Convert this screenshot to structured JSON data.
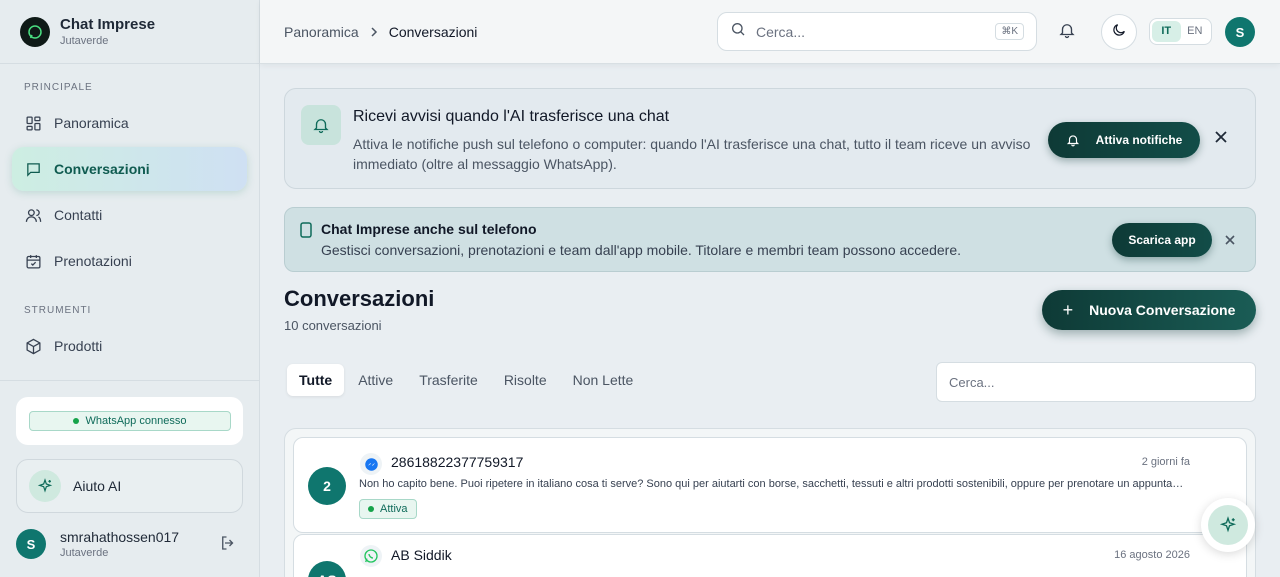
{
  "brand": {
    "name": "Chat Imprese",
    "org": "Jutaverde"
  },
  "sidebar": {
    "section_main": "PRINCIPALE",
    "items": [
      {
        "label": "Panoramica",
        "icon": "dashboard-icon"
      },
      {
        "label": "Conversazioni",
        "icon": "chat-icon",
        "active": true
      },
      {
        "label": "Contatti",
        "icon": "users-icon"
      },
      {
        "label": "Prenotazioni",
        "icon": "calendar-icon"
      }
    ],
    "section_tools": "STRUMENTI",
    "tools": [
      {
        "label": "Prodotti",
        "icon": "box-icon"
      }
    ],
    "whatsapp_status": "WhatsApp connesso",
    "ai_help": "Aiuto AI",
    "user": {
      "initial": "S",
      "name": "smrahathossen017",
      "org": "Jutaverde"
    }
  },
  "header": {
    "breadcrumb": [
      "Panoramica",
      "Conversazioni"
    ],
    "search_placeholder": "Cerca...",
    "shortcut": "⌘K",
    "lang": [
      "IT",
      "EN"
    ],
    "active_lang": "IT",
    "avatar_initial": "S"
  },
  "notify_banner": {
    "title": "Ricevi avvisi quando l'AI trasferisce una chat",
    "text": "Attiva le notifiche push sul telefono o computer: quando l'AI trasferisce una chat, tutto il team riceve un avviso immediato (oltre al messaggio WhatsApp).",
    "button": "Attiva notifiche"
  },
  "app_banner": {
    "title": "Chat Imprese anche sul telefono",
    "text": "Gestisci conversazioni, prenotazioni e team dall'app mobile. Titolare e membri team possono accedere.",
    "button": "Scarica app"
  },
  "page": {
    "title": "Conversazioni",
    "count": "10 conversazioni",
    "new_button": "Nuova Conversazione",
    "plus": "+",
    "tabs": [
      "Tutte",
      "Attive",
      "Trasferite",
      "Risolte",
      "Non Lette"
    ],
    "active_tab": "Tutte",
    "search_placeholder": "Cerca..."
  },
  "conversations": [
    {
      "avatar": "2",
      "channel": "messenger-icon",
      "name": "28618822377759317",
      "date": "2 giorni fa",
      "message": "Non ho capito bene. Puoi ripetere in italiano cosa ti serve? Sono qui per aiutarti con borse, sacchetti, tessuti e altri prodotti sostenibili, oppure per prenotare un appuntamento.",
      "status": "Attiva"
    },
    {
      "avatar": "AS",
      "channel": "whatsapp-icon",
      "name": "AB Siddik",
      "date": "16 agosto 2026",
      "message": "",
      "status": ""
    }
  ],
  "colors": {
    "accent": "#0f766e",
    "dark_button": "#0e3a36",
    "active_nav": "#cdeee2",
    "status_green": "#16a34a"
  }
}
